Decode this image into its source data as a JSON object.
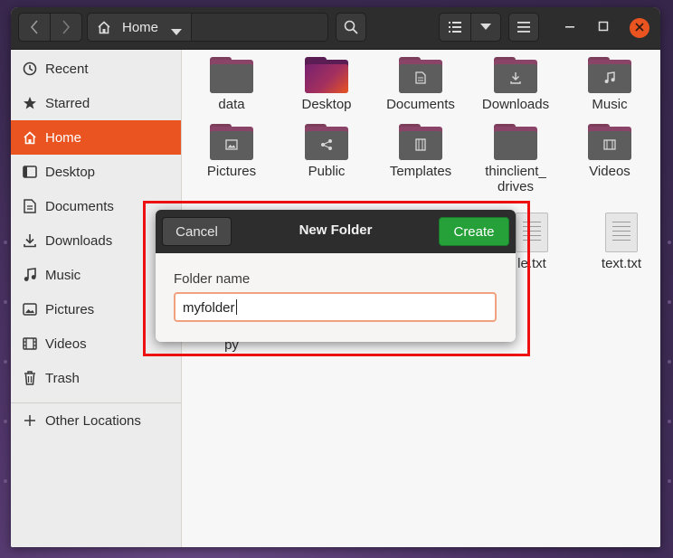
{
  "headerbar": {
    "location_label": "Home",
    "icons": {
      "back": "chevron-left-icon",
      "forward": "chevron-right-icon",
      "home": "home-icon",
      "dropdown": "chevron-down-icon",
      "search": "search-icon",
      "view": "list-view-icon",
      "view_menu": "chevron-down-icon",
      "menu": "hamburger-menu-icon",
      "minimize": "minimize-icon",
      "maximize": "maximize-icon",
      "close": "close-icon"
    }
  },
  "sidebar": {
    "items": [
      {
        "label": "Recent",
        "icon": "clock-icon"
      },
      {
        "label": "Starred",
        "icon": "star-icon"
      },
      {
        "label": "Home",
        "icon": "home-icon",
        "active": true
      },
      {
        "label": "Desktop",
        "icon": "desktop-icon"
      },
      {
        "label": "Documents",
        "icon": "document-icon"
      },
      {
        "label": "Downloads",
        "icon": "download-icon"
      },
      {
        "label": "Music",
        "icon": "music-icon"
      },
      {
        "label": "Pictures",
        "icon": "picture-icon"
      },
      {
        "label": "Videos",
        "icon": "video-icon"
      },
      {
        "label": "Trash",
        "icon": "trash-icon"
      }
    ],
    "other_locations": {
      "label": "Other Locations",
      "icon": "plus-icon"
    }
  },
  "files": [
    {
      "name": "data",
      "type": "folder"
    },
    {
      "name": "Desktop",
      "type": "folder"
    },
    {
      "name": "Documents",
      "type": "folder"
    },
    {
      "name": "Downloads",
      "type": "folder"
    },
    {
      "name": "Music",
      "type": "folder"
    },
    {
      "name": "Pictures",
      "type": "folder"
    },
    {
      "name": "Public",
      "type": "folder"
    },
    {
      "name": "Templates",
      "type": "folder"
    },
    {
      "name": "thinclient_\ndrives",
      "type": "folder"
    },
    {
      "name": "Videos",
      "type": "folder"
    },
    {
      "name": "le.txt",
      "type": "text"
    },
    {
      "name": "text.txt",
      "type": "text"
    },
    {
      "name": "py",
      "type": "text"
    }
  ],
  "dialog": {
    "title": "New Folder",
    "cancel_label": "Cancel",
    "create_label": "Create",
    "field_label": "Folder name",
    "field_value": "myfolder"
  },
  "colors": {
    "accent": "#e95420",
    "create_button": "#26a13a",
    "highlight_box": "#ee1111"
  }
}
